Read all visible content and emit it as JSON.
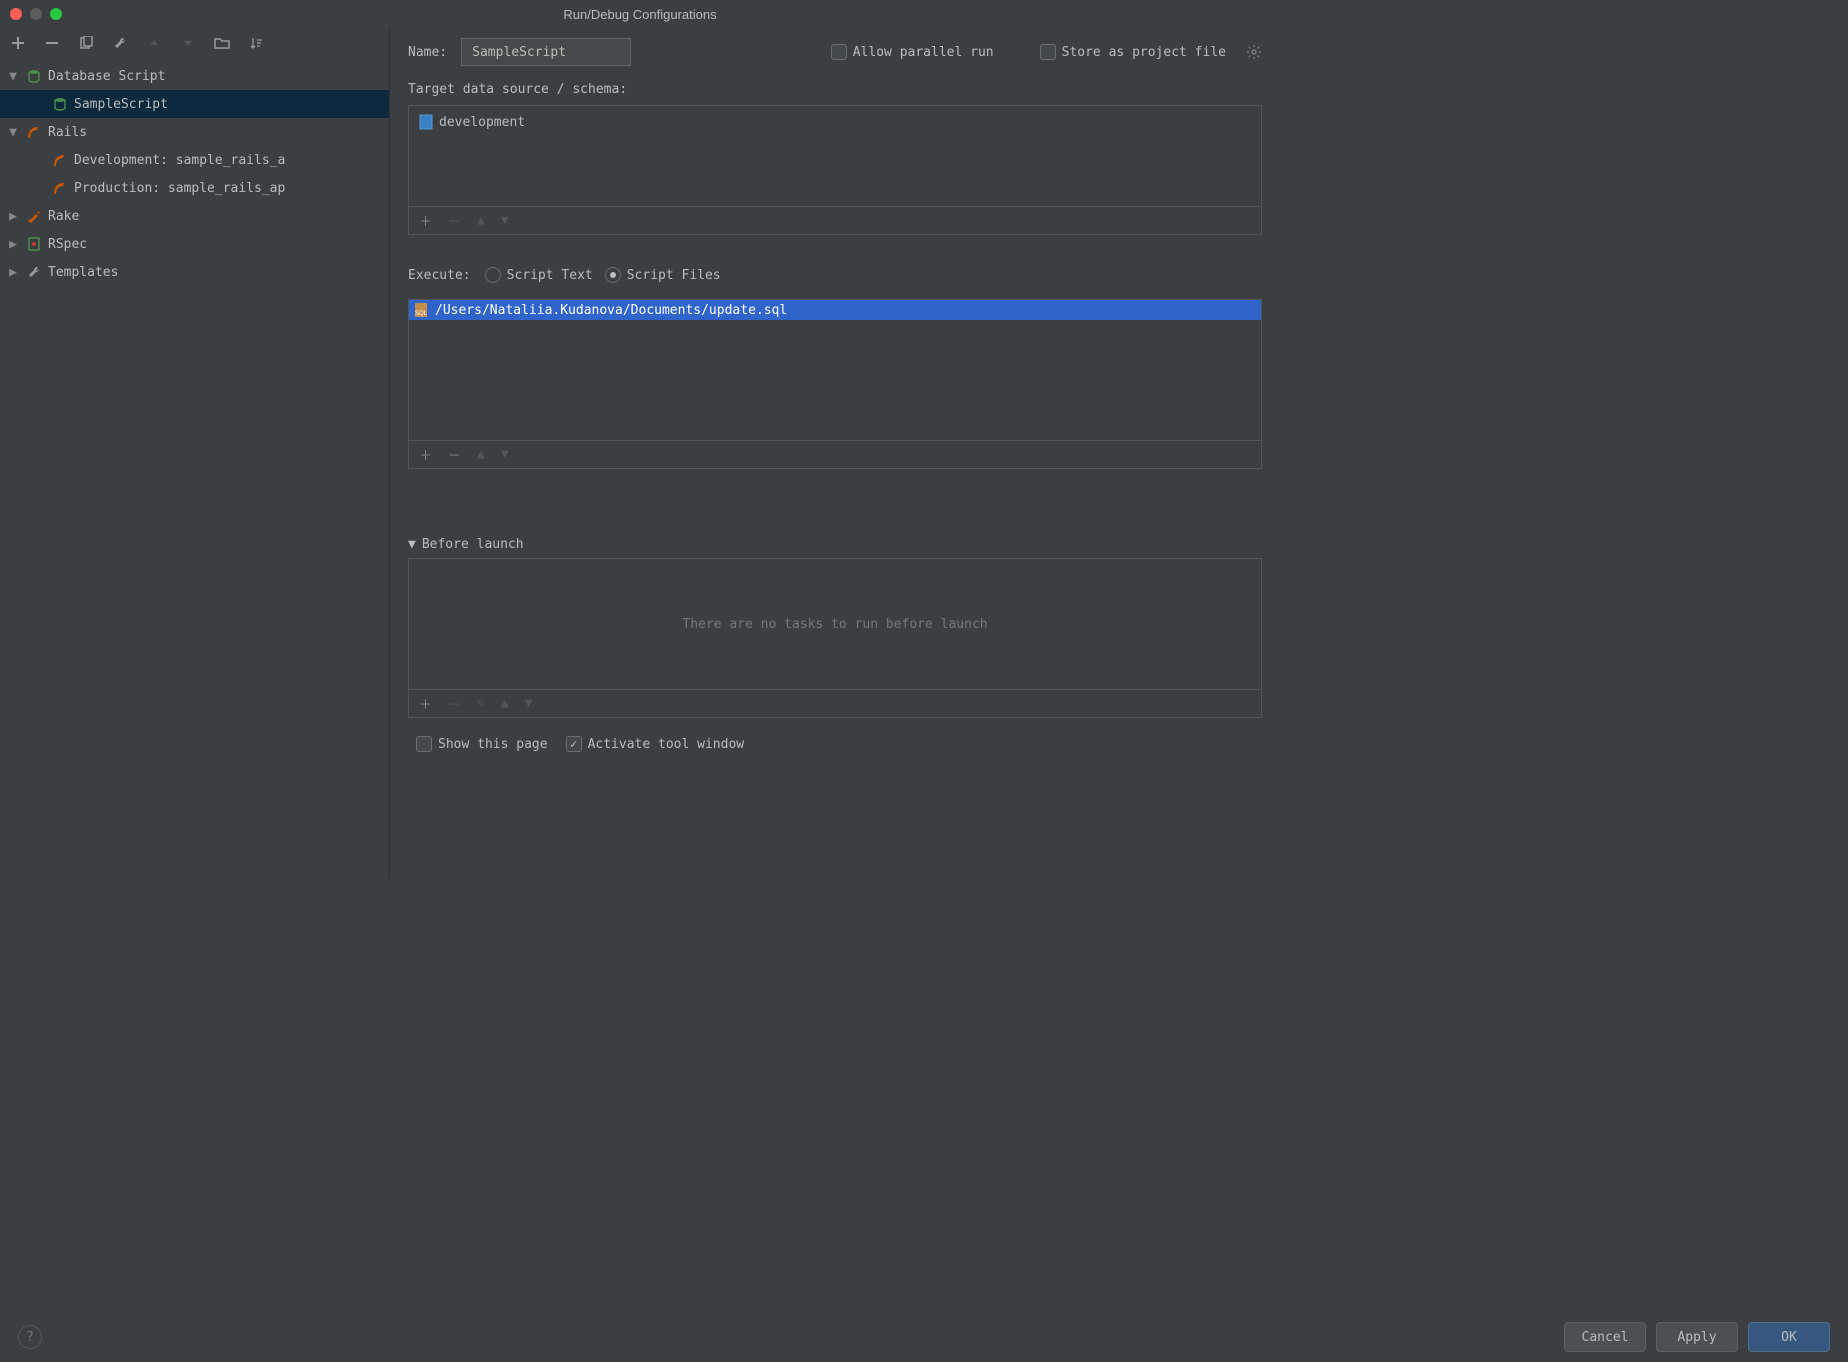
{
  "title": "Run/Debug Configurations",
  "toolbar_icons": [
    "plus",
    "minus",
    "copy",
    "wrench",
    "up",
    "down",
    "folder",
    "sort"
  ],
  "tree": [
    {
      "label": "Database Script",
      "icon": "db",
      "expanded": true,
      "children": [
        {
          "label": "SampleScript",
          "icon": "db",
          "selected": true
        }
      ]
    },
    {
      "label": "Rails",
      "icon": "rails",
      "expanded": true,
      "children": [
        {
          "label": "Development: sample_rails_a",
          "icon": "rails"
        },
        {
          "label": "Production: sample_rails_ap",
          "icon": "rails"
        }
      ]
    },
    {
      "label": "Rake",
      "icon": "rake",
      "expanded": false
    },
    {
      "label": "RSpec",
      "icon": "rspec",
      "expanded": false
    },
    {
      "label": "Templates",
      "icon": "wrench",
      "expanded": false
    }
  ],
  "name_label": "Name:",
  "name_value": "SampleScript",
  "allow_parallel_label": "Allow parallel run",
  "allow_parallel_checked": false,
  "store_project_label": "Store as project file",
  "store_project_checked": false,
  "target_label": "Target data source / schema:",
  "datasource": {
    "name": "development"
  },
  "execute_label": "Execute:",
  "execute_options": [
    "Script Text",
    "Script Files"
  ],
  "execute_selected": 1,
  "script_file": "/Users/Nataliia.Kudanova/Documents/update.sql",
  "before_launch_label": "Before launch",
  "before_launch_empty": "There are no tasks to run before launch",
  "show_page_label": "Show this page",
  "show_page_checked": false,
  "activate_window_label": "Activate tool window",
  "activate_window_checked": true,
  "buttons": {
    "cancel": "Cancel",
    "apply": "Apply",
    "ok": "OK"
  }
}
